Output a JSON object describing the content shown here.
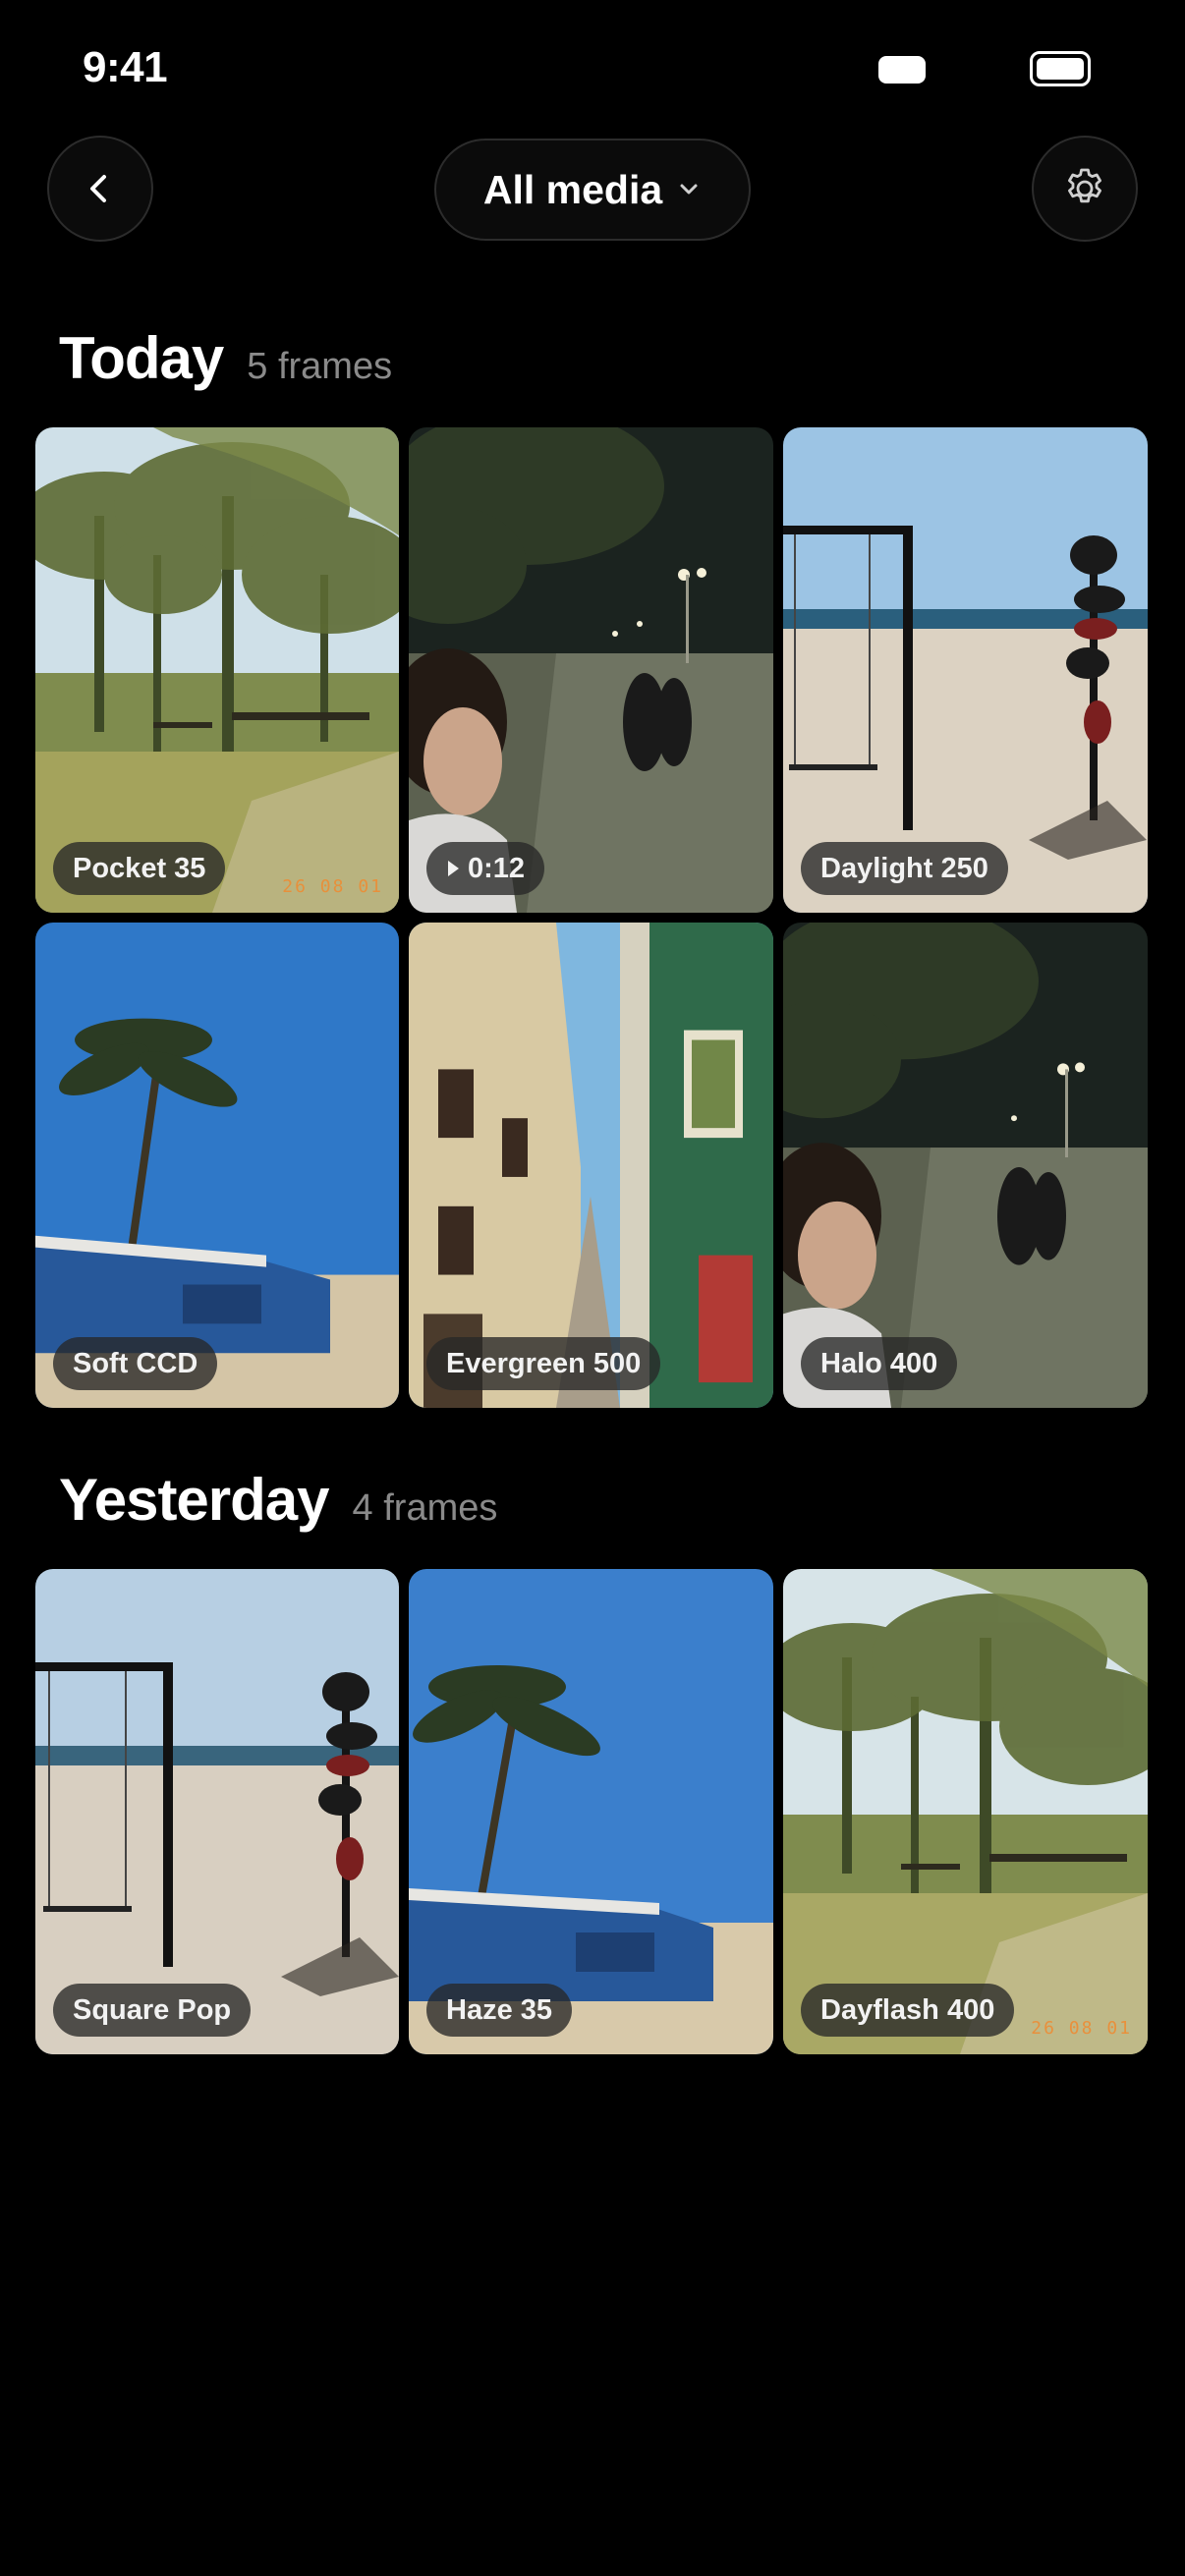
{
  "status": {
    "time": "9:41"
  },
  "header": {
    "filter_label": "All media",
    "icons": {
      "back": "chevron-left-icon",
      "filter": "chevron-down-icon",
      "settings": "gear-icon"
    }
  },
  "sections": [
    {
      "title": "Today",
      "count": "5 frames",
      "items": [
        {
          "label": "Pocket 35",
          "scene": "palms-day",
          "datestamp": "26 08 01"
        },
        {
          "label": "0:12",
          "scene": "night-promenade",
          "video": true
        },
        {
          "label": "Daylight 250",
          "scene": "beach-swing"
        },
        {
          "label": "Soft CCD",
          "scene": "beach-hut"
        },
        {
          "label": "Evergreen 500",
          "scene": "street"
        },
        {
          "label": "Halo 400",
          "scene": "night-promenade"
        }
      ]
    },
    {
      "title": "Yesterday",
      "count": "4 frames",
      "items": [
        {
          "label": "Square Pop",
          "scene": "beach-swing"
        },
        {
          "label": "Haze 35",
          "scene": "beach-hut"
        },
        {
          "label": "Dayflash 400",
          "scene": "palms-day",
          "datestamp": "26 08 01"
        }
      ]
    }
  ],
  "colors": {
    "background": "#000000",
    "badge": "#282828",
    "muted": "#8a8a8a"
  }
}
